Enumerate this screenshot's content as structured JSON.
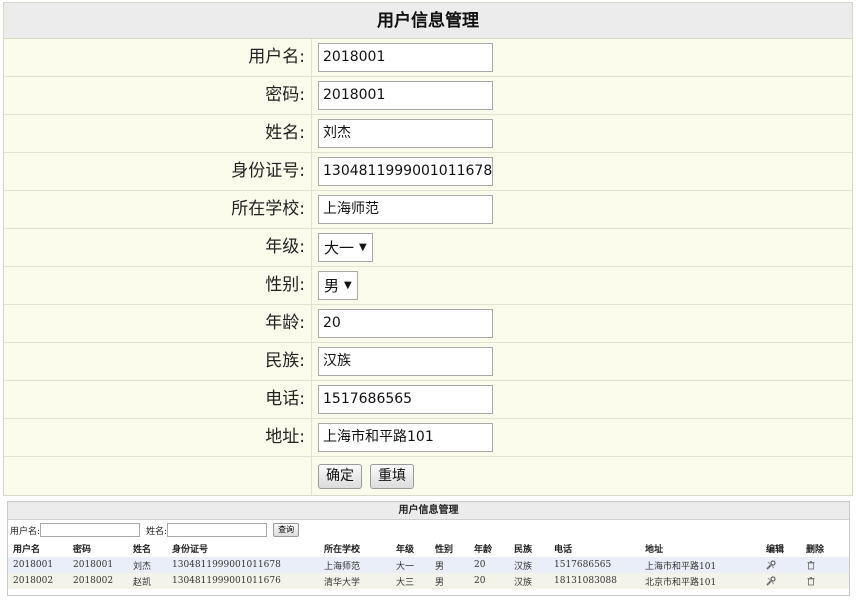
{
  "form": {
    "title": "用户信息管理",
    "fields": [
      {
        "label": "用户名:",
        "value": "2018001",
        "type": "text"
      },
      {
        "label": "密码:",
        "value": "2018001",
        "type": "text"
      },
      {
        "label": "姓名:",
        "value": "刘杰",
        "type": "text"
      },
      {
        "label": "身份证号:",
        "value": "1304811999001011678",
        "type": "text"
      },
      {
        "label": "所在学校:",
        "value": "上海师范",
        "type": "text"
      },
      {
        "label": "年级:",
        "value": "大一",
        "type": "select"
      },
      {
        "label": "性别:",
        "value": "男",
        "type": "select"
      },
      {
        "label": "年龄:",
        "value": "20",
        "type": "text"
      },
      {
        "label": "民族:",
        "value": "汉族",
        "type": "text"
      },
      {
        "label": "电话:",
        "value": "1517686565",
        "type": "text"
      },
      {
        "label": "地址:",
        "value": "上海市和平路101",
        "type": "text"
      }
    ],
    "confirm_label": "确定",
    "reset_label": "重填"
  },
  "list": {
    "title": "用户信息管理",
    "search": {
      "username_label": "用户名:",
      "name_label": "姓名:",
      "query_label": "查询"
    },
    "columns": [
      "用户名",
      "密码",
      "姓名",
      "身份证号",
      "所在学校",
      "年级",
      "性别",
      "年龄",
      "民族",
      "电话",
      "地址",
      "编辑",
      "删除"
    ],
    "rows": [
      [
        "2018001",
        "2018001",
        "刘杰",
        "1304811999001011678",
        "上海师范",
        "大一",
        "男",
        "20",
        "汉族",
        "1517686565",
        "上海市和平路101"
      ],
      [
        "2018002",
        "2018002",
        "赵凯",
        "1304811999001011676",
        "清华大学",
        "大三",
        "男",
        "20",
        "汉族",
        "18131083088",
        "北京市和平路101"
      ]
    ],
    "edit_icon": "wrench-icon",
    "delete_icon": "trash-icon"
  }
}
